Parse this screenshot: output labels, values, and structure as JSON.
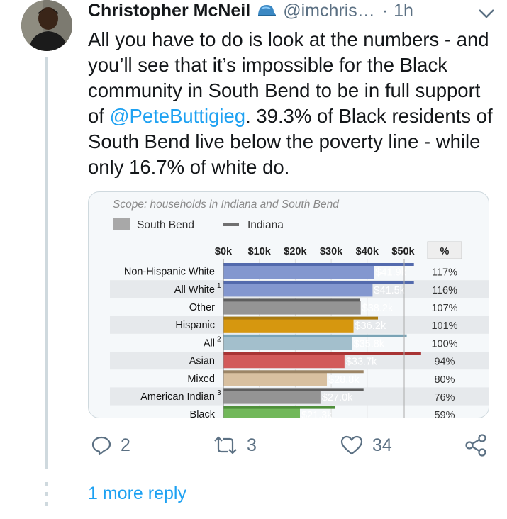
{
  "tweet": {
    "author_name": "Christopher McNeil",
    "author_handle": "@imchris…",
    "separator": "·",
    "time": "1h",
    "text_before_mention": "All you have to do is look at the numbers - and you’ll see that it’s impossible for the Black community in South Bend to be in full support of ",
    "mention": "@PeteButtigieg",
    "text_after_mention": ". 39.3% of Black residents of South Bend live below the poverty line - while only 16.7% of white do."
  },
  "actions": {
    "replies": "2",
    "retweets": "3",
    "likes": "34"
  },
  "more_replies": "1 more reply",
  "icons": {
    "verified": "cap-emoji-icon",
    "caret": "chevron-down-icon",
    "reply": "reply-icon",
    "retweet": "retweet-icon",
    "like": "heart-icon",
    "share": "share-icon"
  },
  "colors": {
    "link": "#1da1f2",
    "muted": "#5b7083"
  },
  "chart_data": {
    "type": "bar",
    "scope_note": "Scope: households in Indiana and South Bend",
    "legend": [
      {
        "label": "South Bend",
        "symbol": "box"
      },
      {
        "label": "Indiana",
        "symbol": "line"
      }
    ],
    "x_ticks": [
      "$0k",
      "$10k",
      "$20k",
      "$30k",
      "$40k",
      "$50k"
    ],
    "pct_header": "%",
    "xlim": [
      0,
      50
    ],
    "categories": [
      "Non-Hispanic White",
      "All White",
      "Other",
      "Hispanic",
      "All",
      "Asian",
      "Mixed",
      "American Indian",
      "Black"
    ],
    "superscripts": [
      "",
      "1",
      "",
      "",
      "2",
      "",
      "",
      "3",
      ""
    ],
    "south_bend_values": [
      41.9,
      41.5,
      38.2,
      36.2,
      35.8,
      33.7,
      28.8,
      27.0,
      21.3
    ],
    "value_labels": [
      "$41.9k",
      "$41.5k",
      "$38.2k",
      "$36.2k",
      "$35.8k",
      "$33.7k",
      "$28.8k",
      "$27.0k",
      "$21.3k"
    ],
    "indiana_values": [
      53,
      53,
      38,
      43,
      51,
      55,
      39,
      39,
      31
    ],
    "percent_labels": [
      "117%",
      "116%",
      "107%",
      "101%",
      "100%",
      "94%",
      "80%",
      "76%",
      "59%"
    ],
    "bar_colors": [
      "#8397cf",
      "#8397cf",
      "#949494",
      "#d6970f",
      "#a3bfcc",
      "#d25a5a",
      "#d8c0a0",
      "#949494",
      "#72b85a"
    ],
    "line_colors": [
      "#536aad",
      "#536aad",
      "#5e5e5e",
      "#a97a10",
      "#7aa3b5",
      "#a83434",
      "#9c8566",
      "#5e5e5e",
      "#4e8f3a"
    ]
  }
}
